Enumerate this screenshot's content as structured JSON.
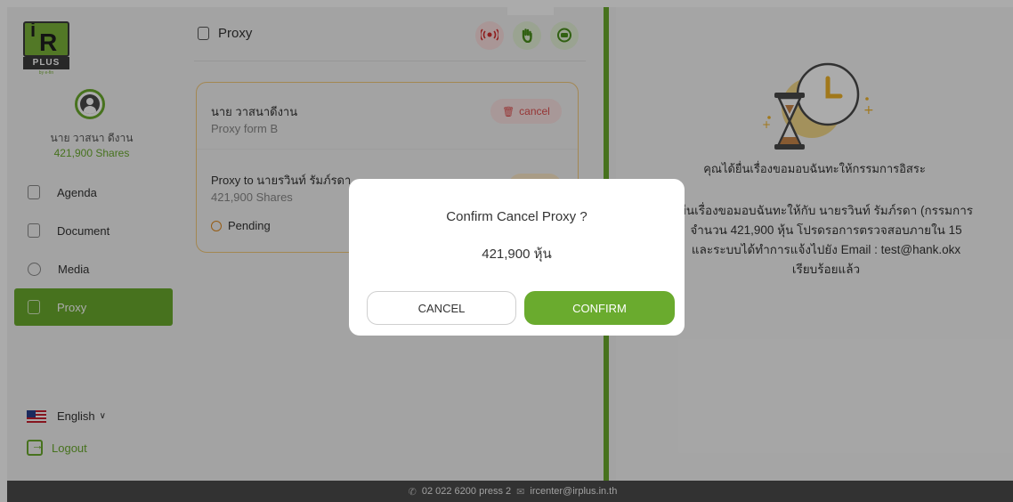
{
  "brand": {
    "logo_text": "PLUS",
    "logo_tag": "by e-fin"
  },
  "user": {
    "name": "นาย วาสนา ดีงาน",
    "shares": "421,900 Shares"
  },
  "nav": [
    {
      "label": "Agenda",
      "icon": "agenda-icon"
    },
    {
      "label": "Document",
      "icon": "document-icon"
    },
    {
      "label": "Media",
      "icon": "media-icon"
    },
    {
      "label": "Proxy",
      "icon": "proxy-icon",
      "active": true
    }
  ],
  "language": {
    "label": "English",
    "icon": "us-flag-icon"
  },
  "logout": {
    "label": "Logout"
  },
  "middle": {
    "title": "Proxy",
    "header_icons": [
      {
        "name": "live-icon",
        "label": "LIVE"
      },
      {
        "name": "raise-hand-icon"
      },
      {
        "name": "chat-icon"
      }
    ],
    "card": {
      "grantor_name": "นาย วาสนาดีงาน",
      "form": "Proxy form B",
      "cancel_label": "cancel",
      "proxy_to": "Proxy to นายรวินท์ รัมภ์รดา",
      "shares": "421,900 Shares",
      "status": "Pending"
    }
  },
  "right": {
    "heading": "คุณได้ยื่นเรื่องขอมอบฉันทะให้กรรมการอิสระ",
    "body_lines": [
      "ยื่นเรื่องขอมอบฉันทะให้กับ นายรวินท์ รัมภ์รดา (กรรมการ",
      "จำนวน 421,900 หุ้น โปรดรอการตรวจสอบภายใน 15",
      "และระบบได้ทำการแจ้งไปยัง Email : test@hank.okx",
      "เรียบร้อยแล้ว"
    ]
  },
  "footer": {
    "phone": "02 022 6200 press 2",
    "email": "ircenter@irplus.in.th"
  },
  "modal": {
    "title": "Confirm Cancel Proxy ?",
    "subtitle": "421,900 หุ้น",
    "cancel_label": "CANCEL",
    "confirm_label": "CONFIRM"
  },
  "colors": {
    "accent": "#6aab2e",
    "danger": "#e05050",
    "warning": "#e08a1e",
    "card_border": "#f3c97a"
  }
}
